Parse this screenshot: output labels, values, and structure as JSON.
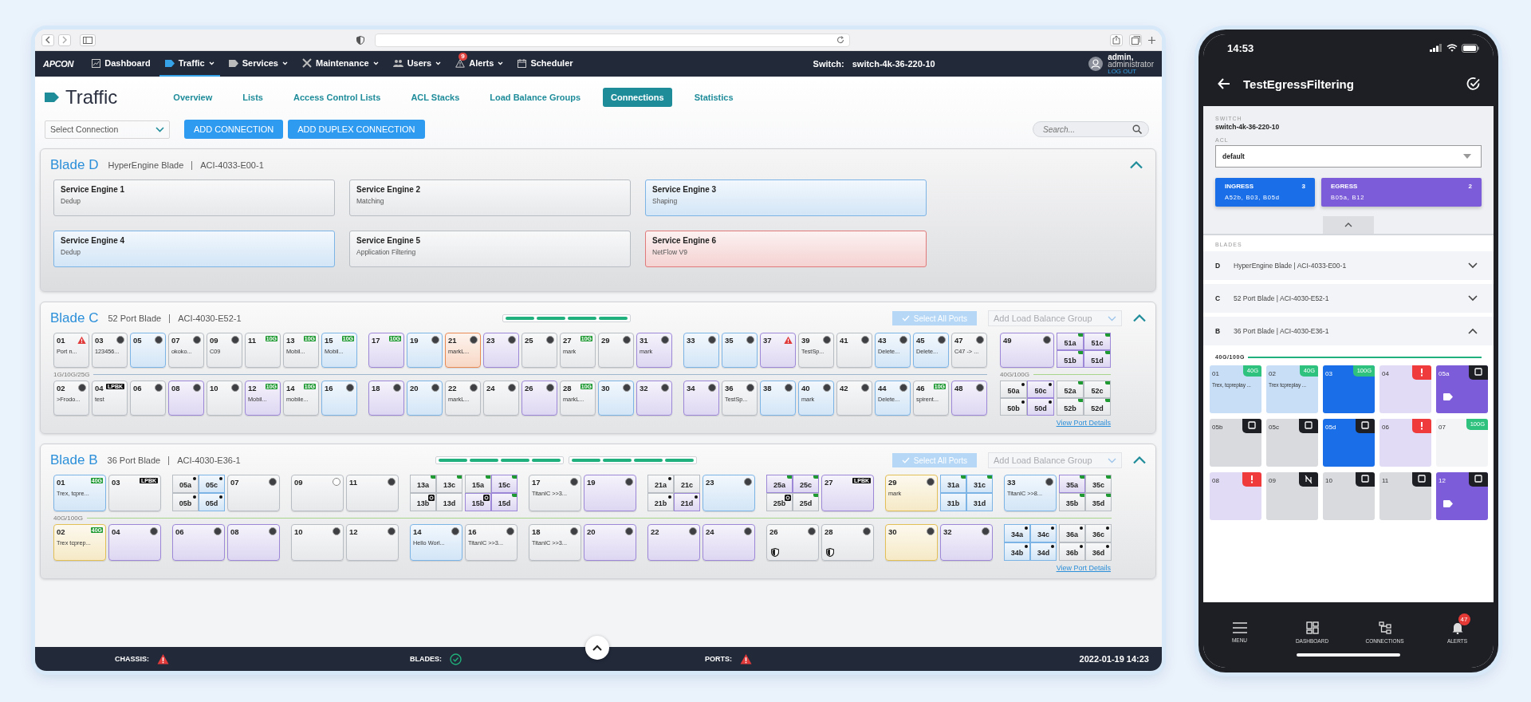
{
  "nav": {
    "logo": "APCON",
    "items": [
      {
        "label": "Dashboard",
        "selected": false,
        "dropdown": false
      },
      {
        "label": "Traffic",
        "selected": true,
        "dropdown": true
      },
      {
        "label": "Services",
        "selected": false,
        "dropdown": true
      },
      {
        "label": "Maintenance",
        "selected": false,
        "dropdown": true
      },
      {
        "label": "Users",
        "selected": false,
        "dropdown": true
      },
      {
        "label": "Alerts",
        "selected": false,
        "dropdown": true,
        "badge": "9"
      },
      {
        "label": "Scheduler",
        "selected": false,
        "dropdown": false
      }
    ],
    "switch_label": "Switch:",
    "switch_name": "switch-4k-36-220-10",
    "user": {
      "name": "admin,",
      "role": "administrator",
      "logout": "LOG OUT"
    }
  },
  "page": {
    "title": "Traffic",
    "tabs": [
      {
        "label": "Overview",
        "selected": false
      },
      {
        "label": "Lists",
        "selected": false
      },
      {
        "label": "Access Control Lists",
        "selected": false
      },
      {
        "label": "ACL Stacks",
        "selected": false
      },
      {
        "label": "Load Balance Groups",
        "selected": false
      },
      {
        "label": "Connections",
        "selected": true
      },
      {
        "label": "Statistics",
        "selected": false
      }
    ],
    "select_connection": {
      "placeholder": "Select Connection"
    },
    "buttons": [
      "ADD CONNECTION",
      "ADD DUPLEX CONNECTION"
    ],
    "search": {
      "placeholder": "Search..."
    }
  },
  "blades": [
    {
      "kind": "engines",
      "name": "Blade D",
      "type": "HyperEngine Blade",
      "model": "ACI-4033-E00-1",
      "expanded": true,
      "engines": [
        {
          "name": "Service Engine 1",
          "detail": "Dedup",
          "color": "#b8bcc3"
        },
        {
          "name": "Service Engine 2",
          "detail": "Matching",
          "color": "#b8bcc3"
        },
        {
          "name": "Service Engine 3",
          "detail": "Shaping",
          "color": "#7db4e6"
        },
        {
          "name": "Service Engine 4",
          "detail": "Dedup",
          "color": "#7db4e6"
        },
        {
          "name": "Service Engine 5",
          "detail": "Application Filtering",
          "color": "#b8bcc3"
        },
        {
          "name": "Service Engine 6",
          "detail": "NetFlow V9",
          "color": "#e07a7a"
        }
      ]
    },
    {
      "kind": "ports",
      "name": "Blade C",
      "type": "52 Port Blade",
      "model": "ACI-4030-E52-1",
      "expanded": true,
      "meters": [
        [
          true,
          true,
          true,
          true
        ]
      ],
      "select_all": "Select All Ports",
      "lb_group": {
        "placeholder": "Add Load Balance Group"
      },
      "details_link": "View Port Details",
      "sections": [
        {
          "speed": "1G/10G/25G",
          "color": "#9fb6cf",
          "top": [
            [
              {
                "kind": "port",
                "label": "01",
                "note": "Port n...",
                "color": "#b8bcc3",
                "badge": {
                  "kind": "alert"
                }
              },
              {
                "kind": "port",
                "label": "03",
                "note": "123456...",
                "color": "#b8bcc3",
                "badge": {
                  "kind": "dot"
                }
              },
              {
                "kind": "port",
                "label": "05",
                "color": "#7db4e6",
                "badge": {
                  "kind": "dot"
                }
              },
              {
                "kind": "port",
                "label": "07",
                "note": "okoko...",
                "color": "#b8bcc3",
                "badge": {
                  "kind": "dot"
                }
              },
              {
                "kind": "port",
                "label": "09",
                "note": "C09",
                "color": "#b8bcc3",
                "badge": {
                  "kind": "dot"
                }
              },
              {
                "kind": "port",
                "label": "11",
                "color": "#b8bcc3",
                "badge": {
                  "kind": "speed",
                  "text": "10G"
                }
              },
              {
                "kind": "port",
                "label": "13",
                "note": "Mobil...",
                "color": "#b8bcc3",
                "badge": {
                  "kind": "speed",
                  "text": "10G"
                }
              },
              {
                "kind": "port",
                "label": "15",
                "note": "Mobil...",
                "color": "#7db4e6",
                "badge": {
                  "kind": "speed",
                  "text": "10G"
                }
              }
            ],
            [
              {
                "kind": "port",
                "label": "17",
                "color": "#9d88d8",
                "badge": {
                  "kind": "speed",
                  "text": "10G"
                }
              },
              {
                "kind": "port",
                "label": "19",
                "color": "#7db4e6",
                "badge": {
                  "kind": "dot"
                }
              },
              {
                "kind": "port",
                "label": "21",
                "note": "markL...",
                "color": "#e98a55",
                "badge": {
                  "kind": "dot"
                }
              },
              {
                "kind": "port",
                "label": "23",
                "color": "#9d88d8",
                "badge": {
                  "kind": "dot"
                }
              },
              {
                "kind": "port",
                "label": "25",
                "color": "#b8bcc3",
                "badge": {
                  "kind": "dot"
                }
              },
              {
                "kind": "port",
                "label": "27",
                "note": "mark",
                "color": "#b8bcc3",
                "badge": {
                  "kind": "speed",
                  "text": "10G"
                }
              },
              {
                "kind": "port",
                "label": "29",
                "color": "#b8bcc3",
                "badge": {
                  "kind": "dot"
                }
              },
              {
                "kind": "port",
                "label": "31",
                "note": "mark",
                "color": "#9d88d8",
                "badge": {
                  "kind": "dot"
                }
              }
            ],
            [
              {
                "kind": "port",
                "label": "33",
                "color": "#7db4e6",
                "badge": {
                  "kind": "dot"
                }
              },
              {
                "kind": "port",
                "label": "35",
                "color": "#7db4e6",
                "badge": {
                  "kind": "dot"
                }
              },
              {
                "kind": "port",
                "label": "37",
                "color": "#9d88d8",
                "badge": {
                  "kind": "alert"
                }
              },
              {
                "kind": "port",
                "label": "39",
                "note": "TestSp...",
                "color": "#b8bcc3",
                "badge": {
                  "kind": "dot"
                }
              },
              {
                "kind": "port",
                "label": "41",
                "color": "#b8bcc3",
                "badge": {
                  "kind": "dot"
                }
              },
              {
                "kind": "port",
                "label": "43",
                "note": "Delete...",
                "color": "#7db4e6",
                "badge": {
                  "kind": "dot"
                }
              },
              {
                "kind": "port",
                "label": "45",
                "note": "Delete...",
                "color": "#7db4e6",
                "badge": {
                  "kind": "dot"
                }
              },
              {
                "kind": "port",
                "label": "47",
                "note": "C47 -> ...",
                "color": "#b8bcc3",
                "badge": {
                  "kind": "dot"
                }
              }
            ]
          ],
          "bottom": [
            [
              {
                "kind": "port",
                "label": "02",
                "note": ">Frodo...",
                "color": "#b8bcc3",
                "badge": {
                  "kind": "dot"
                }
              },
              {
                "kind": "port",
                "label": "04",
                "note": "test",
                "color": "#b8bcc3",
                "badge": {
                  "kind": "loopback",
                  "text": "LPBK"
                }
              },
              {
                "kind": "port",
                "label": "06",
                "color": "#b8bcc3",
                "badge": {
                  "kind": "dot"
                }
              },
              {
                "kind": "port",
                "label": "08",
                "color": "#9d88d8",
                "badge": {
                  "kind": "dot"
                }
              },
              {
                "kind": "port",
                "label": "10",
                "color": "#b8bcc3",
                "badge": {
                  "kind": "dot"
                }
              },
              {
                "kind": "port",
                "label": "12",
                "note": "Mobil...",
                "color": "#9d88d8",
                "badge": {
                  "kind": "speed",
                  "text": "10G"
                }
              },
              {
                "kind": "port",
                "label": "14",
                "note": "mobile...",
                "color": "#b8bcc3",
                "badge": {
                  "kind": "speed",
                  "text": "10G"
                }
              },
              {
                "kind": "port",
                "label": "16",
                "color": "#7db4e6",
                "badge": {
                  "kind": "dot"
                }
              }
            ],
            [
              {
                "kind": "port",
                "label": "18",
                "color": "#9d88d8",
                "badge": {
                  "kind": "dot"
                }
              },
              {
                "kind": "port",
                "label": "20",
                "color": "#7db4e6",
                "badge": {
                  "kind": "dot"
                }
              },
              {
                "kind": "port",
                "label": "22",
                "note": "markL...",
                "color": "#b8bcc3",
                "badge": {
                  "kind": "dot"
                }
              },
              {
                "kind": "port",
                "label": "24",
                "color": "#b8bcc3",
                "badge": {
                  "kind": "dot"
                }
              },
              {
                "kind": "port",
                "label": "26",
                "color": "#9d88d8",
                "badge": {
                  "kind": "dot"
                }
              },
              {
                "kind": "port",
                "label": "28",
                "note": "markL...",
                "color": "#b8bcc3",
                "badge": {
                  "kind": "speed",
                  "text": "10G"
                }
              },
              {
                "kind": "port",
                "label": "30",
                "color": "#7db4e6",
                "badge": {
                  "kind": "dot"
                }
              },
              {
                "kind": "port",
                "label": "32",
                "color": "#9d88d8",
                "badge": {
                  "kind": "dot"
                }
              }
            ],
            [
              {
                "kind": "port",
                "label": "34",
                "color": "#9d88d8",
                "badge": {
                  "kind": "dot"
                }
              },
              {
                "kind": "port",
                "label": "36",
                "note": "TestSp...",
                "color": "#b8bcc3",
                "badge": {
                  "kind": "dot"
                }
              },
              {
                "kind": "port",
                "label": "38",
                "color": "#7db4e6",
                "badge": {
                  "kind": "dot"
                }
              },
              {
                "kind": "port",
                "label": "40",
                "note": "mark",
                "color": "#7db4e6",
                "badge": {
                  "kind": "dot"
                }
              },
              {
                "kind": "port",
                "label": "42",
                "color": "#b8bcc3",
                "badge": {
                  "kind": "dot"
                }
              },
              {
                "kind": "port",
                "label": "44",
                "note": "Delete...",
                "color": "#7db4e6",
                "badge": {
                  "kind": "dot"
                }
              },
              {
                "kind": "port",
                "label": "46",
                "note": "spirent...",
                "color": "#b8bcc3",
                "badge": {
                  "kind": "speed",
                  "text": "10G"
                }
              },
              {
                "kind": "port",
                "label": "48",
                "color": "#9d88d8",
                "badge": {
                  "kind": "dot"
                }
              }
            ]
          ]
        },
        {
          "speed": "40G/100G",
          "color": "#a8d58c",
          "top": [
            [
              {
                "kind": "wide",
                "label": "49",
                "color": "#9d88d8",
                "badge": {
                  "kind": "dot"
                }
              },
              {
                "kind": "quad",
                "subs": [
                  {
                    "label": "51a",
                    "color": "#9d88d8",
                    "marker": {
                      "kind": "link"
                    }
                  },
                  {
                    "label": "51c",
                    "color": "#9d88d8",
                    "marker": {
                      "kind": "link"
                    }
                  },
                  {
                    "label": "51b",
                    "color": "#9d88d8",
                    "marker": {
                      "kind": "link"
                    }
                  },
                  {
                    "label": "51d",
                    "color": "#9d88d8",
                    "marker": {
                      "kind": "link"
                    }
                  }
                ]
              }
            ]
          ],
          "bottom": [
            [
              {
                "kind": "quad",
                "subs": [
                  {
                    "label": "50a",
                    "color": "#b8bcc3",
                    "marker": {
                      "kind": "dot"
                    }
                  },
                  {
                    "label": "50c",
                    "color": "#9d88d8",
                    "marker": {
                      "kind": "dot"
                    }
                  },
                  {
                    "label": "50b",
                    "color": "#b8bcc3",
                    "marker": {
                      "kind": "dot"
                    }
                  },
                  {
                    "label": "50d",
                    "color": "#9d88d8",
                    "marker": {
                      "kind": "dot"
                    }
                  }
                ]
              },
              {
                "kind": "quad",
                "subs": [
                  {
                    "label": "52a",
                    "color": "#b8bcc3",
                    "marker": {
                      "kind": "link"
                    }
                  },
                  {
                    "label": "52c",
                    "color": "#b8bcc3",
                    "marker": {
                      "kind": "link"
                    }
                  },
                  {
                    "label": "52b",
                    "color": "#b8bcc3",
                    "marker": {
                      "kind": "link"
                    }
                  },
                  {
                    "label": "52d",
                    "color": "#b8bcc3",
                    "marker": {
                      "kind": "link"
                    }
                  }
                ]
              }
            ]
          ]
        }
      ]
    },
    {
      "kind": "ports",
      "name": "Blade B",
      "type": "36 Port Blade",
      "model": "ACI-4030-E36-1",
      "expanded": true,
      "meters": [
        [
          true,
          true,
          true,
          true
        ],
        [
          true,
          true,
          true,
          true
        ]
      ],
      "select_all": "Select All Ports",
      "lb_group": {
        "placeholder": "Add Load Balance Group"
      },
      "details_link": "View Port Details",
      "sections": [
        {
          "speed": "40G/100G",
          "color": "#a8d58c",
          "top": [
            [
              {
                "kind": "wide",
                "label": "01",
                "note": "Trex, tcpre...",
                "color": "#7db4e6",
                "badge": {
                  "kind": "speed",
                  "text": "40G"
                }
              },
              {
                "kind": "wide",
                "label": "03",
                "color": "#b8bcc3",
                "badge": {
                  "kind": "loopback",
                  "text": "LPBK"
                }
              }
            ],
            [
              {
                "kind": "quad",
                "subs": [
                  {
                    "label": "05a",
                    "color": "#b8bcc3",
                    "marker": {
                      "kind": "dot"
                    }
                  },
                  {
                    "label": "05c",
                    "color": "#7db4e6",
                    "marker": {
                      "kind": "dot"
                    }
                  },
                  {
                    "label": "05b",
                    "color": "#b8bcc3",
                    "marker": {
                      "kind": "dot"
                    }
                  },
                  {
                    "label": "05d",
                    "color": "#7db4e6",
                    "marker": {
                      "kind": "dot"
                    }
                  }
                ]
              },
              {
                "kind": "wide",
                "label": "07",
                "color": "#b8bcc3",
                "badge": {
                  "kind": "dot"
                }
              }
            ],
            [
              {
                "kind": "wide",
                "label": "09",
                "color": "#b8bcc3",
                "badge": {
                  "kind": "ring"
                }
              },
              {
                "kind": "wide",
                "label": "11",
                "color": "#b8bcc3",
                "badge": {
                  "kind": "dot"
                }
              }
            ],
            [
              {
                "kind": "quad",
                "subs": [
                  {
                    "label": "13a",
                    "color": "#b8bcc3",
                    "marker": {
                      "kind": "link"
                    }
                  },
                  {
                    "label": "13c",
                    "color": "#b8bcc3",
                    "marker": {
                      "kind": "link"
                    }
                  },
                  {
                    "label": "13b",
                    "color": "#b8bcc3",
                    "marker": {
                      "kind": "boxed"
                    }
                  },
                  {
                    "label": "13d",
                    "color": "#b8bcc3"
                  }
                ]
              },
              {
                "kind": "quad",
                "subs": [
                  {
                    "label": "15a",
                    "color": "#b8bcc3",
                    "marker": {
                      "kind": "link"
                    }
                  },
                  {
                    "label": "15c",
                    "color": "#9d88d8",
                    "marker": {
                      "kind": "link"
                    }
                  },
                  {
                    "label": "15b",
                    "color": "#9d88d8",
                    "marker": {
                      "kind": "boxed"
                    }
                  },
                  {
                    "label": "15d",
                    "color": "#9d88d8",
                    "marker": {
                      "kind": "link"
                    }
                  }
                ]
              }
            ],
            [
              {
                "kind": "wide",
                "label": "17",
                "note": "TitanIC >>3...",
                "color": "#b8bcc3",
                "badge": {
                  "kind": "dot"
                }
              },
              {
                "kind": "wide",
                "label": "19",
                "color": "#9d88d8",
                "badge": {
                  "kind": "dot"
                }
              }
            ],
            [
              {
                "kind": "quad",
                "subs": [
                  {
                    "label": "21a",
                    "color": "#b8bcc3",
                    "marker": {
                      "kind": "dot"
                    }
                  },
                  {
                    "label": "21c",
                    "color": "#b8bcc3"
                  },
                  {
                    "label": "21b",
                    "color": "#b8bcc3",
                    "marker": {
                      "kind": "dot"
                    }
                  },
                  {
                    "label": "21d",
                    "color": "#9d88d8",
                    "marker": {
                      "kind": "dot"
                    }
                  }
                ]
              },
              {
                "kind": "wide",
                "label": "23",
                "color": "#7db4e6",
                "badge": {
                  "kind": "dot"
                }
              }
            ],
            [
              {
                "kind": "quad",
                "subs": [
                  {
                    "label": "25a",
                    "color": "#9d88d8",
                    "marker": {
                      "kind": "link"
                    }
                  },
                  {
                    "label": "25c",
                    "color": "#9d88d8",
                    "marker": {
                      "kind": "link"
                    }
                  },
                  {
                    "label": "25b",
                    "color": "#b8bcc3",
                    "marker": {
                      "kind": "boxed"
                    }
                  },
                  {
                    "label": "25d",
                    "color": "#b8bcc3",
                    "marker": {
                      "kind": "link"
                    }
                  }
                ]
              },
              {
                "kind": "wide",
                "label": "27",
                "color": "#9d88d8",
                "badge": {
                  "kind": "loopback",
                  "text": "LPBK"
                }
              }
            ],
            [
              {
                "kind": "wide",
                "label": "29",
                "note": "mark",
                "color": "#e3bf57",
                "badge": {
                  "kind": "dot"
                }
              },
              {
                "kind": "quad",
                "subs": [
                  {
                    "label": "31a",
                    "color": "#7db4e6",
                    "marker": {
                      "kind": "link"
                    }
                  },
                  {
                    "label": "31c",
                    "color": "#7db4e6",
                    "marker": {
                      "kind": "link"
                    }
                  },
                  {
                    "label": "31b",
                    "color": "#7db4e6"
                  },
                  {
                    "label": "31d",
                    "color": "#7db4e6"
                  }
                ]
              }
            ],
            [
              {
                "kind": "wide",
                "label": "33",
                "note": "TitanIC >>8...",
                "color": "#7db4e6",
                "badge": {
                  "kind": "dot"
                }
              },
              {
                "kind": "quad",
                "subs": [
                  {
                    "label": "35a",
                    "color": "#9d88d8",
                    "marker": {
                      "kind": "link"
                    }
                  },
                  {
                    "label": "35c",
                    "color": "#b8bcc3",
                    "marker": {
                      "kind": "link"
                    }
                  },
                  {
                    "label": "35b",
                    "color": "#b8bcc3",
                    "marker": {
                      "kind": "link"
                    }
                  },
                  {
                    "label": "35d",
                    "color": "#b8bcc3",
                    "marker": {
                      "kind": "link"
                    }
                  }
                ]
              }
            ]
          ],
          "bottom": [
            [
              {
                "kind": "wide",
                "label": "02",
                "note": "Trex tcprep...",
                "color": "#e3bf57",
                "badge": {
                  "kind": "speed",
                  "text": "40G"
                }
              },
              {
                "kind": "wide",
                "label": "04",
                "color": "#9d88d8",
                "badge": {
                  "kind": "dot"
                }
              }
            ],
            [
              {
                "kind": "wide",
                "label": "06",
                "color": "#9d88d8",
                "badge": {
                  "kind": "dot"
                }
              },
              {
                "kind": "wide",
                "label": "08",
                "color": "#9d88d8",
                "badge": {
                  "kind": "dot"
                }
              }
            ],
            [
              {
                "kind": "wide",
                "label": "10",
                "color": "#b8bcc3",
                "badge": {
                  "kind": "dot"
                }
              },
              {
                "kind": "wide",
                "label": "12",
                "color": "#b8bcc3",
                "badge": {
                  "kind": "dot"
                }
              }
            ],
            [
              {
                "kind": "wide",
                "label": "14",
                "note": "Hello Worl...",
                "color": "#7db4e6",
                "badge": {
                  "kind": "dot"
                }
              },
              {
                "kind": "wide",
                "label": "16",
                "note": "TitanIC >>3...",
                "color": "#b8bcc3",
                "badge": {
                  "kind": "dot"
                }
              }
            ],
            [
              {
                "kind": "wide",
                "label": "18",
                "note": "TitanIC >>3...",
                "color": "#b8bcc3",
                "badge": {
                  "kind": "dot"
                }
              },
              {
                "kind": "wide",
                "label": "20",
                "color": "#9d88d8",
                "badge": {
                  "kind": "dot"
                }
              }
            ],
            [
              {
                "kind": "wide",
                "label": "22",
                "color": "#9d88d8",
                "badge": {
                  "kind": "dot"
                }
              },
              {
                "kind": "wide",
                "label": "24",
                "color": "#9d88d8",
                "badge": {
                  "kind": "dot"
                }
              }
            ],
            [
              {
                "kind": "wide",
                "label": "26",
                "color": "#b8bcc3",
                "badge": {
                  "kind": "dot"
                },
                "shield": true
              },
              {
                "kind": "wide",
                "label": "28",
                "color": "#b8bcc3",
                "badge": {
                  "kind": "dot"
                },
                "shield": true
              }
            ],
            [
              {
                "kind": "wide",
                "label": "30",
                "color": "#e3bf57",
                "badge": {
                  "kind": "dot"
                }
              },
              {
                "kind": "wide",
                "label": "32",
                "color": "#9d88d8",
                "badge": {
                  "kind": "dot"
                }
              }
            ],
            [
              {
                "kind": "quad",
                "subs": [
                  {
                    "label": "34a",
                    "color": "#7db4e6",
                    "marker": {
                      "kind": "dot"
                    }
                  },
                  {
                    "label": "34c",
                    "color": "#7db4e6",
                    "marker": {
                      "kind": "dot"
                    }
                  },
                  {
                    "label": "34b",
                    "color": "#7db4e6",
                    "marker": {
                      "kind": "dot"
                    }
                  },
                  {
                    "label": "34d",
                    "color": "#7db4e6",
                    "marker": {
                      "kind": "dot"
                    }
                  }
                ]
              },
              {
                "kind": "quad",
                "subs": [
                  {
                    "label": "36a",
                    "color": "#b8bcc3",
                    "marker": {
                      "kind": "dot"
                    }
                  },
                  {
                    "label": "36c",
                    "color": "#b8bcc3",
                    "marker": {
                      "kind": "dot"
                    }
                  },
                  {
                    "label": "36b",
                    "color": "#b8bcc3",
                    "marker": {
                      "kind": "dot"
                    }
                  },
                  {
                    "label": "36d",
                    "color": "#b8bcc3",
                    "marker": {
                      "kind": "dot"
                    }
                  }
                ]
              }
            ]
          ]
        }
      ]
    }
  ],
  "status_bar": {
    "items": [
      {
        "label": "CHASSIS:",
        "kind": "alert"
      },
      {
        "label": "BLADES:",
        "kind": "ok"
      },
      {
        "label": "PORTS:",
        "kind": "alert"
      }
    ],
    "timestamp": "2022-01-19 14:23"
  },
  "mobile": {
    "time": "14:53",
    "title": "TestEgressFiltering",
    "switch_label": "SWITCH",
    "switch_name": "switch-4k-36-220-10",
    "acl_label": "ACL",
    "acl": {
      "value": "default"
    },
    "directions": [
      {
        "label": "INGRESS",
        "count": "3",
        "ports": "A52b, B03, B05d",
        "color": "#1a6fe8"
      },
      {
        "label": "EGRESS",
        "count": "2",
        "ports": "B05a, B12",
        "color": "#7c5cd8"
      }
    ],
    "blades_label": "BLADES",
    "blades": [
      {
        "letter": "D",
        "description": "HyperEngine Blade | ACI-4033-E00-1",
        "expanded": false
      },
      {
        "letter": "C",
        "description": "52 Port Blade | ACI-4030-E52-1",
        "expanded": false
      },
      {
        "letter": "B",
        "description": "36 Port Blade | ACI-4030-E36-1",
        "expanded": true
      }
    ],
    "speed": "40G/100G",
    "tiles": [
      {
        "label": "01",
        "note": "Trex, tcpreplay ...",
        "color": "#c7def6",
        "corner": {
          "kind": "speed",
          "text": "40G"
        }
      },
      {
        "label": "02",
        "note": "Trex tcpreplay ...",
        "color": "#c7def6",
        "corner": {
          "kind": "speed",
          "text": "40G"
        }
      },
      {
        "label": "03",
        "color": "#1a6fe8",
        "corner": {
          "kind": "speed",
          "text": "100G"
        }
      },
      {
        "label": "04",
        "color": "#e2dbf5",
        "corner": {
          "kind": "alert"
        }
      },
      {
        "label": "05a",
        "color": "#7c5cd8",
        "corner": {
          "kind": "select"
        },
        "tagged": true
      },
      {
        "label": "05b",
        "color": "#d8dade",
        "corner": {
          "kind": "select"
        }
      },
      {
        "label": "05c",
        "color": "#d8dade",
        "corner": {
          "kind": "select"
        }
      },
      {
        "label": "05d",
        "color": "#1a6fe8",
        "corner": {
          "kind": "select"
        }
      },
      {
        "label": "06",
        "color": "#e2dbf5",
        "corner": {
          "kind": "alert"
        }
      },
      {
        "label": "07",
        "color": "#f3f4f6",
        "corner": {
          "kind": "speed",
          "text": "100G"
        }
      },
      {
        "label": "08",
        "color": "#e2dbf5",
        "corner": {
          "kind": "alert"
        }
      },
      {
        "label": "09",
        "color": "#d8dade",
        "corner": {
          "kind": "unlinked"
        }
      },
      {
        "label": "10",
        "color": "#d8dade",
        "corner": {
          "kind": "select"
        }
      },
      {
        "label": "11",
        "color": "#d8dade",
        "corner": {
          "kind": "select"
        }
      },
      {
        "label": "12",
        "color": "#7c5cd8",
        "corner": {
          "kind": "select"
        },
        "tagged": true
      }
    ],
    "tabs": [
      {
        "label": "MENU"
      },
      {
        "label": "DASHBOARD"
      },
      {
        "label": "CONNECTIONS"
      },
      {
        "label": "ALERTS",
        "badge": "47"
      }
    ]
  }
}
